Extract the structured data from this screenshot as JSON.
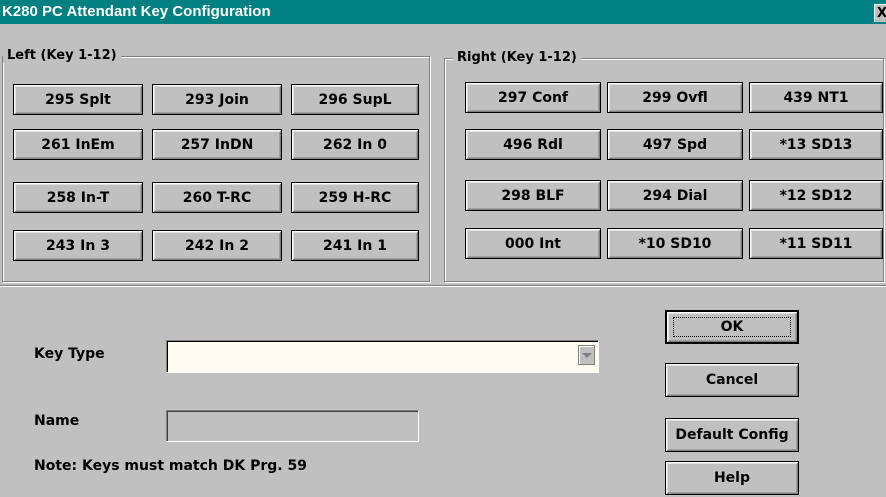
{
  "window": {
    "title": "K280 PC Attendant Key Configuration",
    "close_glyph": "X"
  },
  "left_group": {
    "label": "Left (Key 1-12)",
    "keys": [
      "295 Splt",
      "293 Join",
      "296 SupL",
      "261 InEm",
      "257 InDN",
      "262 In 0",
      "258 In-T",
      "260 T-RC",
      "259 H-RC",
      "243 In 3",
      "242 In 2",
      "241 In 1"
    ]
  },
  "right_group": {
    "label": "Right (Key 1-12)",
    "keys": [
      "297 Conf",
      "299 Ovfl",
      "439 NT1",
      "496 Rdl",
      "497 Spd",
      "*13 SD13",
      "298 BLF",
      "294 Dial",
      "*12 SD12",
      "000 Int",
      "*10 SD10",
      "*11 SD11"
    ]
  },
  "form": {
    "key_type_label": "Key Type",
    "key_type_value": "",
    "name_label": "Name",
    "name_value": "",
    "note": "Note:  Keys must match DK Prg. 59"
  },
  "buttons": {
    "ok": "OK",
    "cancel": "Cancel",
    "default_config": "Default Config",
    "help": "Help"
  },
  "colors": {
    "titlebar": "#008080",
    "face": "#c0c0c0",
    "combo_field": "#fffbf0"
  }
}
